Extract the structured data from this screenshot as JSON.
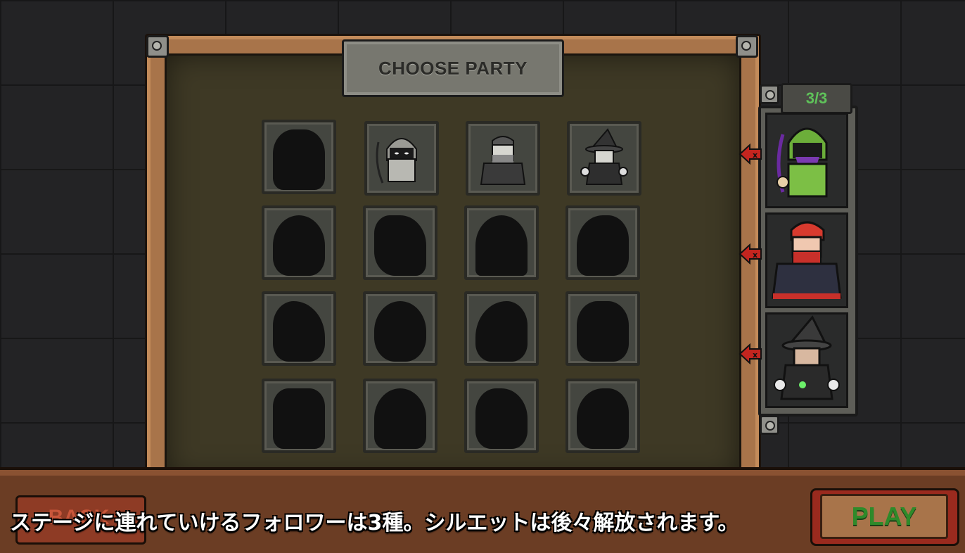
{
  "screen": {
    "title": "CHOOSE PARTY",
    "party_count": "3/3"
  },
  "roster": {
    "unlocked": [
      {
        "slot": 2,
        "name": "archer-hood",
        "state": "unlocked"
      },
      {
        "slot": 3,
        "name": "bearded-brawler",
        "state": "unlocked"
      },
      {
        "slot": 4,
        "name": "wizard",
        "state": "unlocked"
      }
    ],
    "locked_count": 13
  },
  "party": {
    "members": [
      {
        "name": "archer-hood",
        "color": "#6cae3a"
      },
      {
        "name": "bearded-brawler",
        "color": "#c8302a"
      },
      {
        "name": "wizard",
        "color": "#3a3a3a"
      }
    ]
  },
  "buttons": {
    "back": "BACK",
    "play": "PLAY"
  },
  "subtitle": "ステージに連れていけるフォロワーは3種。シルエットは後々解放されます。",
  "colors": {
    "count_green": "#5fc25a",
    "play_green": "#2f8a2a",
    "wood": "#a8744a",
    "remove_red": "#c4251f"
  }
}
